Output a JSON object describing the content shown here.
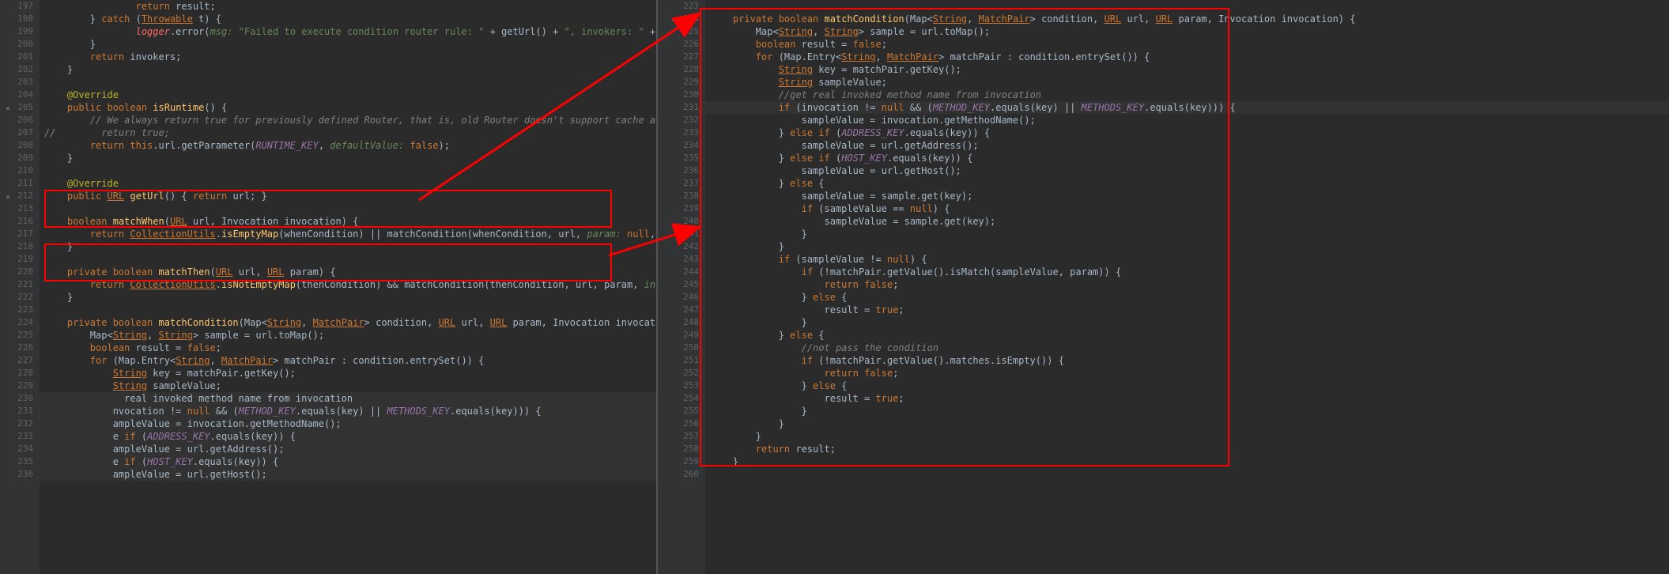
{
  "left": {
    "startLine": 197,
    "lines": [
      {
        "n": 197,
        "indent": 4,
        "raw": "<span class='kw'>return</span> result;"
      },
      {
        "n": 198,
        "indent": 2,
        "raw": "} <span class='kw'>catch</span> (<span class='lnkc'>Throwable</span> t) {"
      },
      {
        "n": 199,
        "indent": 4,
        "raw": "<span class='err'>logger</span>.error(<span class='param'>msg:</span> <span class='str'>\"Failed to execute condition router rule: \"</span> + getUrl() + <span class='str'>\", invokers: \"</span> + invokers + <span class='str'>\", cause: \"</span> + t.g"
      },
      {
        "n": 200,
        "indent": 2,
        "raw": "}"
      },
      {
        "n": 201,
        "indent": 2,
        "raw": "<span class='kw'>return</span> invokers;"
      },
      {
        "n": 202,
        "indent": 1,
        "raw": "}"
      },
      {
        "n": 203,
        "indent": 0,
        "raw": ""
      },
      {
        "n": 204,
        "indent": 1,
        "raw": "<span class='ann'>@Override</span>"
      },
      {
        "n": 205,
        "indent": 1,
        "raw": "<span class='kw'>public boolean</span> <span class='fn'>isRuntime</span>() {",
        "mark": true
      },
      {
        "n": 206,
        "indent": 2,
        "raw": "<span class='cmt'>// We always return true for previously defined Router, that is, old Router doesn't support cache anymore.</span>"
      },
      {
        "n": 207,
        "indent": 0,
        "raw": "<span class='cmt'>//        return true;</span>"
      },
      {
        "n": 208,
        "indent": 2,
        "raw": "<span class='kw'>return this</span>.url.getParameter(<span class='const'>RUNTIME_KEY</span>, <span class='param'>defaultValue:</span> <span class='kw'>false</span>);"
      },
      {
        "n": 209,
        "indent": 1,
        "raw": "}"
      },
      {
        "n": 210,
        "indent": 0,
        "raw": ""
      },
      {
        "n": 211,
        "indent": 1,
        "raw": "<span class='ann'>@Override</span>"
      },
      {
        "n": 212,
        "indent": 1,
        "raw": "<span class='kw'>public</span> <span class='lnkc'>URL</span> <span class='fn'>getUrl</span>() { <span class='kw'>return</span> url; }",
        "mark": true
      },
      {
        "n": 213,
        "indent": 0,
        "raw": ""
      },
      {
        "n": 216,
        "indent": 1,
        "raw": "<span class='kw'>boolean</span> <span class='fn'>matchWhen</span>(<span class='lnkc'>URL</span> url, Invocation invocation) {"
      },
      {
        "n": 217,
        "indent": 2,
        "raw": "<span class='kw'>return</span> <span class='lnkc'>CollectionUtils</span>.<span class='fn'>isEmptyMap</span>(whenCondition) || matchCondition(whenCondition, url, <span class='param'>param:</span> <span class='kw'>null</span>, invocation);"
      },
      {
        "n": 218,
        "indent": 1,
        "raw": "}"
      },
      {
        "n": 219,
        "indent": 0,
        "raw": ""
      },
      {
        "n": 220,
        "indent": 1,
        "raw": "<span class='kw'>private boolean</span> <span class='fn'>matchThen</span>(<span class='lnkc'>URL</span> url, <span class='lnkc'>URL</span> param) {"
      },
      {
        "n": 221,
        "indent": 2,
        "raw": "<span class='kw'>return</span> <span class='lnkc'>CollectionUtils</span>.<span class='fn'>isNotEmptyMap</span>(thenCondition) && matchCondition(thenCondition, url, param, <span class='param'>invocation:</span> <span class='kw'>null</span>);"
      },
      {
        "n": 222,
        "indent": 1,
        "raw": "}"
      },
      {
        "n": 223,
        "indent": 0,
        "raw": ""
      },
      {
        "n": 224,
        "indent": 1,
        "raw": "<span class='kw'>private boolean</span> <span class='fn'>matchCondition</span>(Map&lt;<span class='lnkc'>String</span>, <span class='lnkc'>MatchPair</span>&gt; condition, <span class='lnkc'>URL</span> url, <span class='lnkc'>URL</span> param, Invocation invocation) {"
      },
      {
        "n": 225,
        "indent": 2,
        "raw": "Map&lt;<span class='lnkc'>String</span>, <span class='lnkc'>String</span>&gt; sample = url.toMap();"
      },
      {
        "n": 226,
        "indent": 2,
        "raw": "<span class='kw'>boolean</span> result = <span class='kw'>false</span>;"
      },
      {
        "n": 227,
        "indent": 2,
        "raw": "<span class='kw'>for</span> (Map.Entry&lt;<span class='lnkc'>String</span>, <span class='lnkc'>MatchPair</span>&gt; matchPair : condition.entrySet()) {"
      },
      {
        "n": 228,
        "indent": 3,
        "raw": "<span class='lnkc'>String</span> key = matchPair.getKey();"
      },
      {
        "n": 229,
        "indent": 3,
        "raw": "<span class='lnkc'>String</span> sampleValue;"
      },
      {
        "n": 230,
        "indent": 3,
        "raw": "  real invoked method name from invocation",
        "hl": true
      },
      {
        "n": 231,
        "indent": 3,
        "raw": "nvocation != <span class='kw'>null</span> && (<span class='const'>METHOD_KEY</span>.equals(key) || <span class='const'>METHODS_KEY</span>.equals(key))) {",
        "hl": true
      },
      {
        "n": 232,
        "indent": 3,
        "raw": "ampleValue = invocation.getMethodName();",
        "hl": true
      },
      {
        "n": 233,
        "indent": 3,
        "raw": "e <span class='kw'>if</span> (<span class='const'>ADDRESS_KEY</span>.equals(key)) {",
        "hl": true
      },
      {
        "n": 234,
        "indent": 3,
        "raw": "ampleValue = url.getAddress();",
        "hl": true
      },
      {
        "n": 235,
        "indent": 3,
        "raw": "e <span class='kw'>if</span> (<span class='const'>HOST_KEY</span>.equals(key)) {",
        "hl": true
      },
      {
        "n": 236,
        "indent": 3,
        "raw": "ampleValue = url.getHost();",
        "hl": true
      }
    ]
  },
  "right": {
    "startLine": 223,
    "lines": [
      {
        "n": 223,
        "indent": 0,
        "raw": ""
      },
      {
        "n": 224,
        "indent": 1,
        "raw": "<span class='kw'>private boolean</span> <span class='fn'>matchCondition</span>(Map&lt;<span class='lnkc'>String</span>, <span class='lnkc'>MatchPair</span>&gt; condition, <span class='lnkc'>URL</span> url, <span class='lnkc'>URL</span> param, Invocation invocation) {",
        "mark": true
      },
      {
        "n": 225,
        "indent": 2,
        "raw": "Map&lt;<span class='lnkc'>String</span>, <span class='lnkc'>String</span>&gt; sample = url.toMap();"
      },
      {
        "n": 226,
        "indent": 2,
        "raw": "<span class='kw'>boolean</span> result = <span class='kw'>false</span>;"
      },
      {
        "n": 227,
        "indent": 2,
        "raw": "<span class='kw'>for</span> (Map.Entry&lt;<span class='lnkc'>String</span>, <span class='lnkc'>MatchPair</span>&gt; matchPair : condition.entrySet()) {"
      },
      {
        "n": 228,
        "indent": 3,
        "raw": "<span class='lnkc'>String</span> key = matchPair.getKey();"
      },
      {
        "n": 229,
        "indent": 3,
        "raw": "<span class='lnkc'>String</span> sampleValue;"
      },
      {
        "n": 230,
        "indent": 3,
        "raw": "<span class='cmt'>//get real invoked method name from invocation</span>"
      },
      {
        "n": 231,
        "indent": 3,
        "raw": "<span class='kw'>if</span> (invocation != <span class='kw'>null</span> && (<span class='const'>METHOD_KEY</span>.equals(key) || <span class='const'>METHODS_KEY</span>.equals(key))) {",
        "hl": true
      },
      {
        "n": 232,
        "indent": 4,
        "raw": "sampleValue = invocation.getMethodName();"
      },
      {
        "n": 233,
        "indent": 3,
        "raw": "} <span class='kw'>else if</span> (<span class='const'>ADDRESS_KEY</span>.equals(key)) {"
      },
      {
        "n": 234,
        "indent": 4,
        "raw": "sampleValue = url.getAddress();"
      },
      {
        "n": 235,
        "indent": 3,
        "raw": "} <span class='kw'>else if</span> (<span class='const'>HOST_KEY</span>.equals(key)) {"
      },
      {
        "n": 236,
        "indent": 4,
        "raw": "sampleValue = url.getHost();"
      },
      {
        "n": 237,
        "indent": 3,
        "raw": "} <span class='kw'>else</span> {"
      },
      {
        "n": 238,
        "indent": 4,
        "raw": "sampleValue = sample.get(key);"
      },
      {
        "n": 239,
        "indent": 4,
        "raw": "<span class='kw'>if</span> (sampleValue == <span class='kw'>null</span>) {"
      },
      {
        "n": 240,
        "indent": 5,
        "raw": "sampleValue = sample.get(key);"
      },
      {
        "n": 241,
        "indent": 4,
        "raw": "}"
      },
      {
        "n": 242,
        "indent": 3,
        "raw": "}"
      },
      {
        "n": 243,
        "indent": 3,
        "raw": "<span class='kw'>if</span> (sampleValue != <span class='kw'>null</span>) {"
      },
      {
        "n": 244,
        "indent": 4,
        "raw": "<span class='kw'>if</span> (!matchPair.getValue().isMatch(sampleValue, param)) {"
      },
      {
        "n": 245,
        "indent": 5,
        "raw": "<span class='kw'>return false</span>;"
      },
      {
        "n": 246,
        "indent": 4,
        "raw": "} <span class='kw'>else</span> {"
      },
      {
        "n": 247,
        "indent": 5,
        "raw": "result = <span class='kw'>true</span>;"
      },
      {
        "n": 248,
        "indent": 4,
        "raw": "}"
      },
      {
        "n": 249,
        "indent": 3,
        "raw": "} <span class='kw'>else</span> {"
      },
      {
        "n": 250,
        "indent": 4,
        "raw": "<span class='cmt'>//not pass the condition</span>"
      },
      {
        "n": 251,
        "indent": 4,
        "raw": "<span class='kw'>if</span> (!matchPair.getValue().matches.isEmpty()) {"
      },
      {
        "n": 252,
        "indent": 5,
        "raw": "<span class='kw'>return false</span>;"
      },
      {
        "n": 253,
        "indent": 4,
        "raw": "} <span class='kw'>else</span> {"
      },
      {
        "n": 254,
        "indent": 5,
        "raw": "result = <span class='kw'>true</span>;"
      },
      {
        "n": 255,
        "indent": 4,
        "raw": "}"
      },
      {
        "n": 256,
        "indent": 3,
        "raw": "}"
      },
      {
        "n": 257,
        "indent": 2,
        "raw": "}"
      },
      {
        "n": 258,
        "indent": 2,
        "raw": "<span class='kw'>return</span> result;"
      },
      {
        "n": 259,
        "indent": 1,
        "raw": "}"
      },
      {
        "n": 260,
        "indent": 0,
        "raw": ""
      }
    ]
  }
}
